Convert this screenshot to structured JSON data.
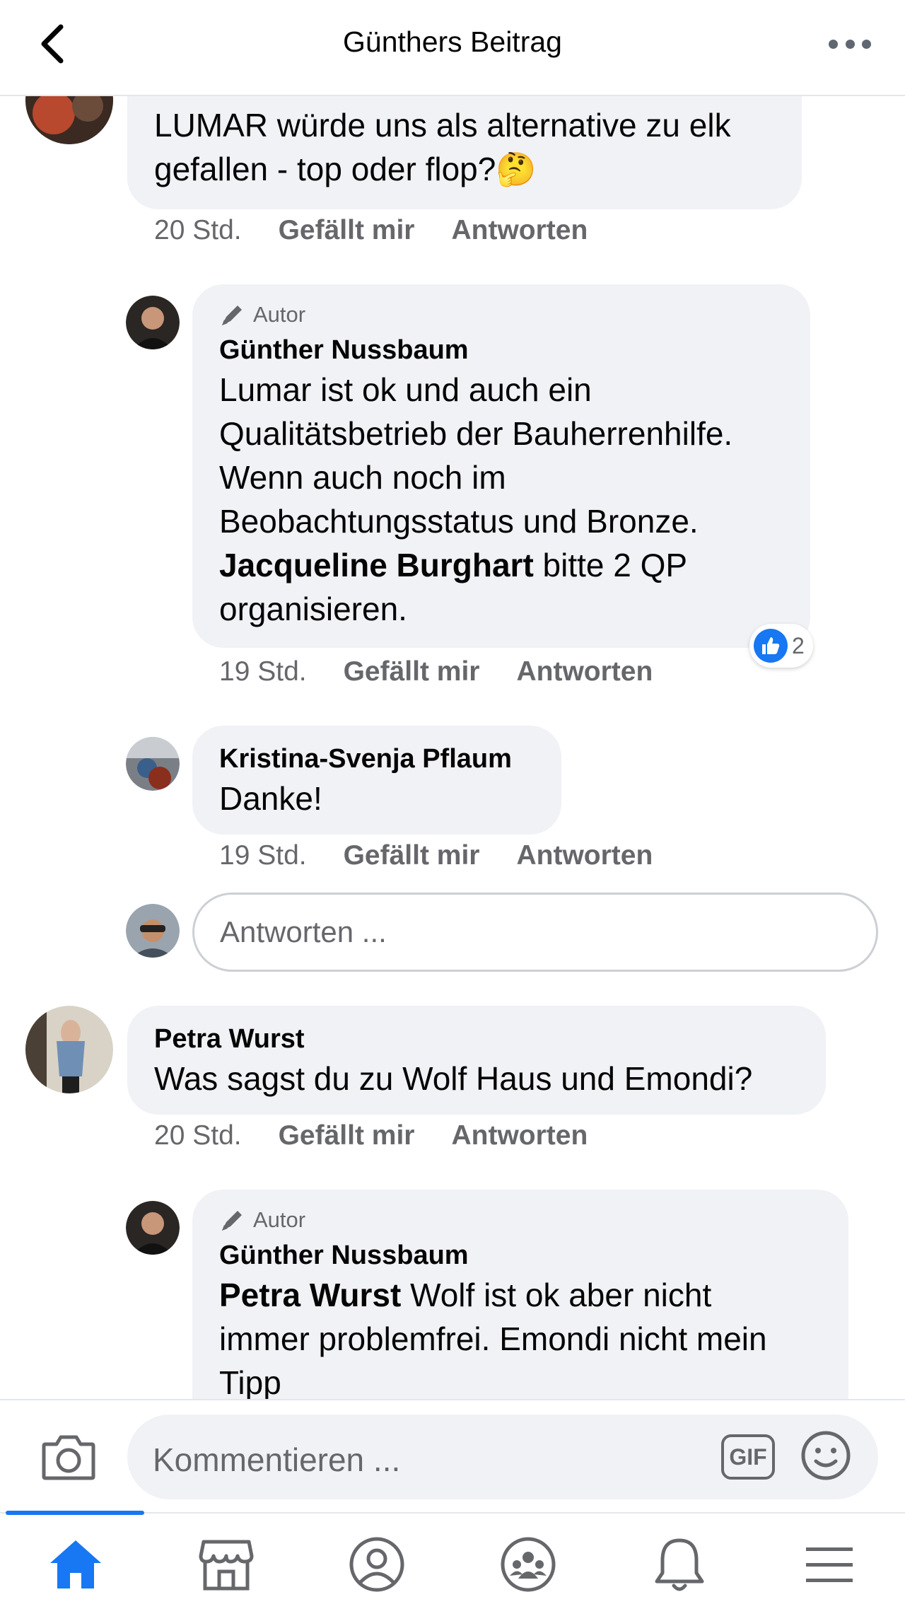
{
  "header": {
    "title": "Günthers Beitrag"
  },
  "comments": [
    {
      "text": "LUMAR würde uns als alternative zu elk gefallen - top oder flop?🤔",
      "time": "20 Std.",
      "like_label": "Gefällt mir",
      "reply_label": "Antworten"
    },
    {
      "badge": "Autor",
      "author": "Günther Nussbaum",
      "text_line1": "Lumar ist ok und auch ein",
      "text_line2": "Qualitätsbetrieb der Bauherrenhilfe.",
      "text_line3": "Wenn auch noch im",
      "text_line4": "Beobachtungsstatus und Bronze.",
      "mention": "Jacqueline Burghart",
      "text_after_mention": " bitte 2 QP",
      "text_line6": "organisieren.",
      "time": "19 Std.",
      "like_label": "Gefällt mir",
      "reply_label": "Antworten",
      "reaction_count": "2"
    },
    {
      "author": "Kristina-Svenja Pflaum",
      "text": "Danke!",
      "time": "19 Std.",
      "like_label": "Gefällt mir",
      "reply_label": "Antworten"
    },
    {
      "author": "Petra Wurst",
      "text": "Was sagst du zu Wolf Haus und Emondi?",
      "time": "20 Std.",
      "like_label": "Gefällt mir",
      "reply_label": "Antworten"
    },
    {
      "badge": "Autor",
      "author": "Günther Nussbaum",
      "mention": "Petra Wurst",
      "text_after_mention": " Wolf ist ok aber nicht",
      "text_line2": "immer problemfrei. Emondi nicht mein",
      "text_line3": "Tipp"
    }
  ],
  "reply_box": {
    "placeholder": "Antworten ..."
  },
  "composer": {
    "placeholder": "Kommentieren ...",
    "gif_label": "GIF"
  },
  "colors": {
    "accent": "#1877f2",
    "bubble": "#f0f2f5",
    "secondary_text": "#65676b"
  },
  "nav_icons": [
    "home-icon",
    "marketplace-icon",
    "profile-icon",
    "groups-icon",
    "notifications-icon",
    "menu-icon"
  ]
}
